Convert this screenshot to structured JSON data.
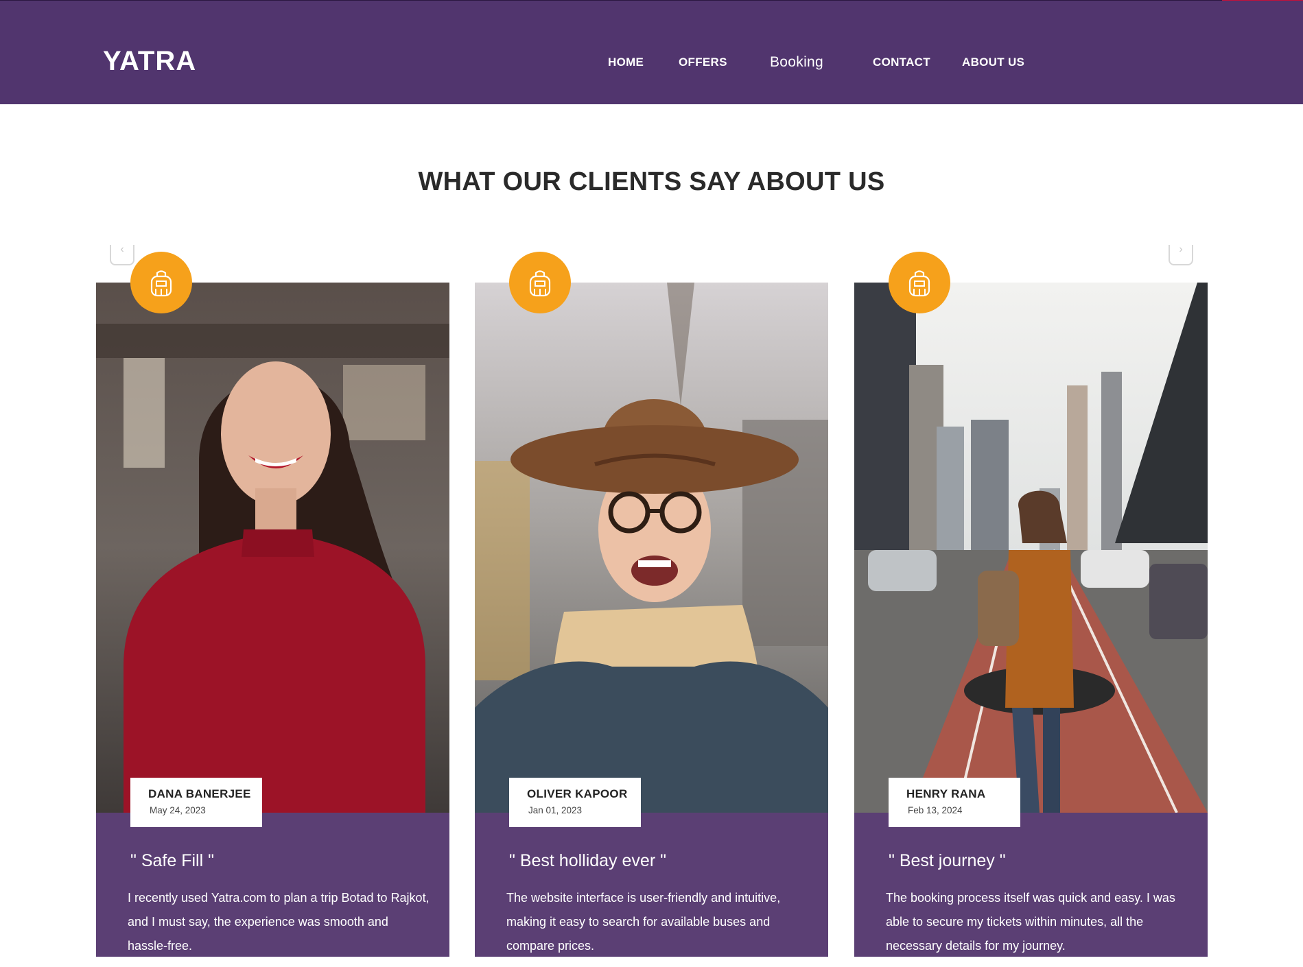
{
  "brand": {
    "logo": "YATRA"
  },
  "nav": {
    "items": [
      {
        "label": "HOME"
      },
      {
        "label": "OFFERS"
      },
      {
        "label": "Booking"
      },
      {
        "label": "CONTACT"
      },
      {
        "label": "ABOUT US"
      }
    ]
  },
  "testimonials": {
    "title": "WHAT OUR CLIENTS SAY ABOUT US",
    "prev_icon": "chevron-left-icon",
    "next_icon": "chevron-right-icon",
    "badge_icon": "backpack-icon",
    "cards": [
      {
        "name": "DANA BANERJEE",
        "date": "May 24, 2023",
        "quote": "\" Safe Fill \"",
        "text": "I recently used Yatra.com to plan a trip Botad to Rajkot, and I must say, the experience was smooth and hassle-free."
      },
      {
        "name": "OLIVER KAPOOR",
        "date": "Jan 01, 2023",
        "quote": "\" Best holliday ever \"",
        "text": "The website interface is user-friendly and intuitive, making it easy to search for available buses and compare prices."
      },
      {
        "name": "HENRY RANA",
        "date": "Feb 13, 2024",
        "quote": "\" Best journey \"",
        "text": "The booking process itself was quick and easy. I was able to secure my tickets within minutes, all the necessary details for my journey."
      }
    ]
  },
  "colors": {
    "navbar": "#51356e",
    "card_body": "#5b3f74",
    "badge": "#f6a11b",
    "title_text": "#2a2a2a"
  }
}
